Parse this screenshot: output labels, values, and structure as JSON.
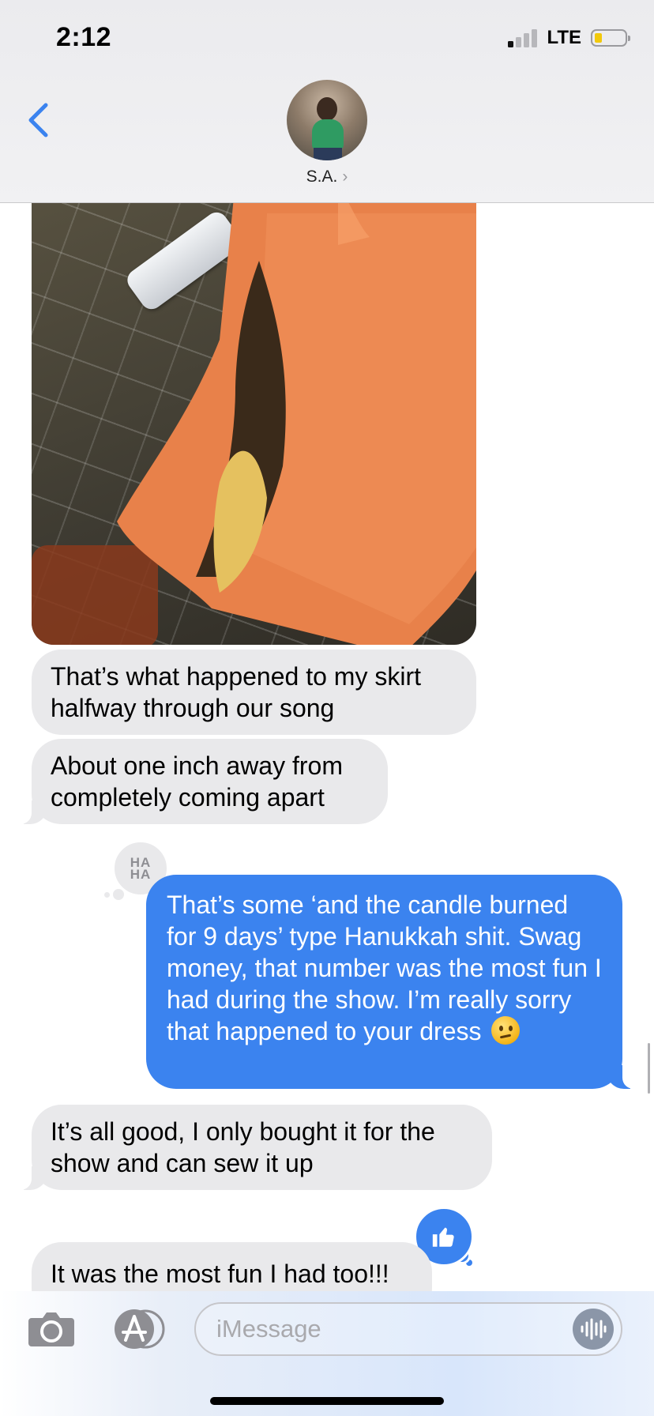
{
  "status_bar": {
    "time": "2:12",
    "network": "LTE",
    "signal_bars_active": 1,
    "signal_bars_total": 4,
    "battery_level": 0.2,
    "battery_color": "#f2c90c"
  },
  "header": {
    "back_icon": "chevron-left-icon",
    "contact_name": "S.A.",
    "contact_chevron": "›"
  },
  "messages": [
    {
      "type": "image",
      "direction": "received",
      "description_icon": "photo-attachment"
    },
    {
      "type": "text",
      "direction": "received",
      "text": "That’s what happened to my skirt halfway through our song"
    },
    {
      "type": "text",
      "direction": "received",
      "text": "About one inch away from completely coming apart"
    },
    {
      "type": "text",
      "direction": "sent",
      "text": "That’s some ‘and the candle burned for 9 days’ type Hanukkah shit. Swag money, that number was the most fun I had during the show. I’m really sorry that happened to your dress",
      "emoji": "confused-face-emoji",
      "tapback": {
        "label_line1": "HA",
        "label_line2": "HA"
      }
    },
    {
      "type": "text",
      "direction": "received",
      "text": "It’s all good, I only bought it for the show and can sew it up"
    },
    {
      "type": "text",
      "direction": "received",
      "text": "It was the most fun I had too!!!",
      "tapback": "thumbs-up-icon"
    }
  ],
  "input_bar": {
    "camera_icon": "camera-icon",
    "apps_icon": "app-store-icon",
    "placeholder": "iMessage",
    "audio_icon": "audio-waveform-icon"
  },
  "colors": {
    "sent_bubble": "#3b83ef",
    "received_bubble": "#e9e9eb",
    "accent": "#3b83ef"
  }
}
